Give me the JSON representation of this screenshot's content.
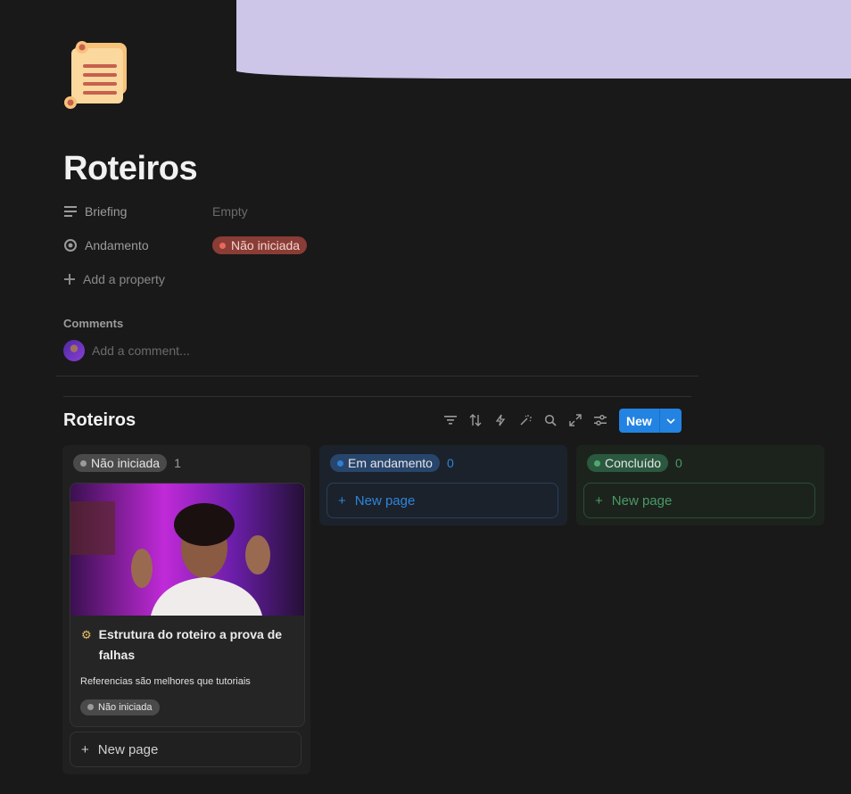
{
  "page": {
    "icon": "scroll-icon",
    "title": "Roteiros"
  },
  "properties": [
    {
      "icon": "text-lines-icon",
      "name": "Briefing",
      "value": "Empty"
    },
    {
      "icon": "status-icon",
      "name": "Andamento",
      "value": "Não iniciada",
      "color": "#e8685b"
    }
  ],
  "add_property_label": "Add a property",
  "comments": {
    "title": "Comments",
    "placeholder": "Add a comment..."
  },
  "database": {
    "title": "Roteiros",
    "toolbar_icons": [
      "filter-icon",
      "sort-icon",
      "lightning-icon",
      "magic-icon",
      "search-icon",
      "expand-icon",
      "settings-icon"
    ],
    "new_label": "New",
    "accent": "#2383e2",
    "columns": [
      {
        "label": "Não iniciada",
        "count": "1",
        "color": "#9b9b9b",
        "cards": [
          {
            "icon": "gear-icon",
            "title": "Estrutura do roteiro a prova de falhas",
            "subtitle": "Referencias são melhores que tutoriais",
            "status": "Não iniciada"
          }
        ],
        "new_page_label": "New page"
      },
      {
        "label": "Em andamento",
        "count": "0",
        "color": "#2f7fd2",
        "new_page_label": "New page"
      },
      {
        "label": "Concluído",
        "count": "0",
        "color": "#4fa870",
        "new_page_label": "New page"
      }
    ]
  }
}
